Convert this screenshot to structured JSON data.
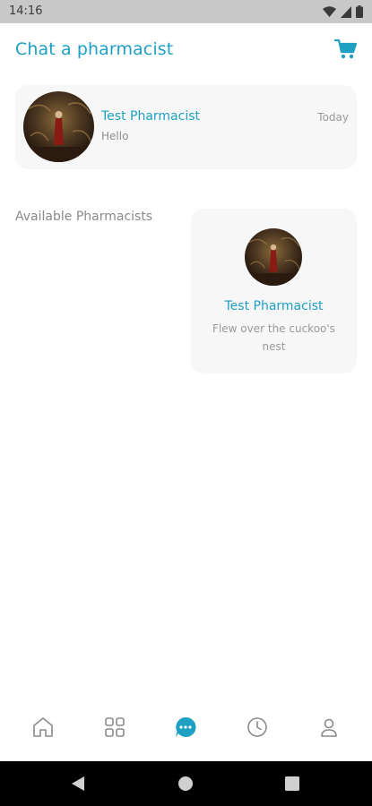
{
  "status_bar": {
    "time": "14:16",
    "icons": [
      "wifi-icon",
      "signal-icon",
      "battery-icon"
    ]
  },
  "header": {
    "title": "Chat a pharmacist",
    "cart_icon": "cart-icon"
  },
  "chats": [
    {
      "name": "Test Pharmacist",
      "last_message": "Hello",
      "time": "Today"
    }
  ],
  "available_section": {
    "label": "Available Pharmacists",
    "pharmacists": [
      {
        "name": "Test Pharmacist",
        "description": "Flew over the cuckoo's nest"
      }
    ]
  },
  "bottom_nav": {
    "items": [
      "home-icon",
      "grid-icon",
      "chat-icon",
      "clock-icon",
      "profile-icon"
    ],
    "active": "chat-icon"
  },
  "system_nav": {
    "buttons": [
      "back-icon",
      "home-circle-icon",
      "recents-icon"
    ]
  },
  "colors": {
    "accent": "#1ea0c3",
    "card_bg": "#f7f7f7",
    "muted_text": "#9a9a9a"
  }
}
